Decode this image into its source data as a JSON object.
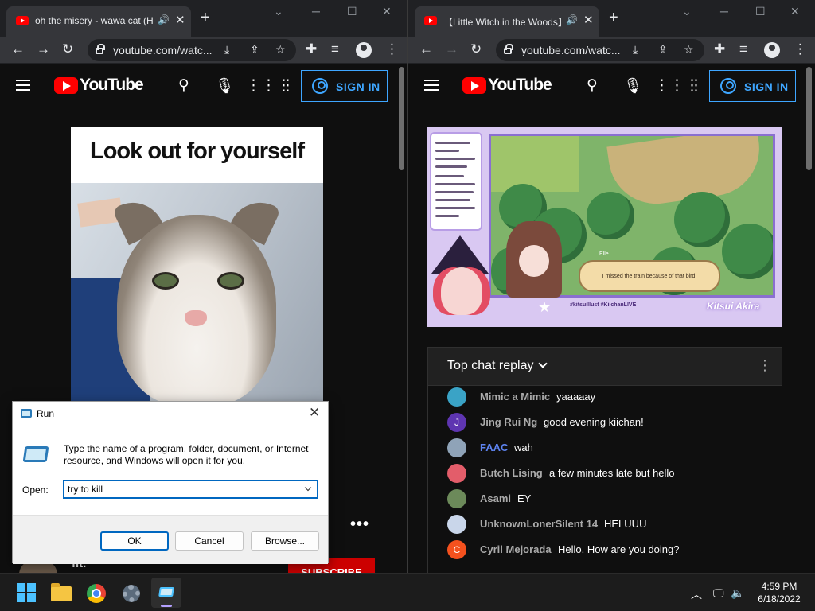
{
  "left_window": {
    "tab_title": "oh the misery - wawa cat (H",
    "url": "youtube.com/watc...",
    "youtube_logo_text": "YouTube",
    "sign_in_label": "SIGN IN",
    "video_caption": "Look out for yourself",
    "more_label": "•••",
    "channel_name": "fit.",
    "subscribe_label": "SUBSCRIBE"
  },
  "right_window": {
    "tab_title": "【Little Witch in the Woods】",
    "url": "youtube.com/watc...",
    "youtube_logo_text": "YouTube",
    "sign_in_label": "SIGN IN",
    "game": {
      "speaker": "Elle",
      "dialog": "I missed the train because of that bird.",
      "hashtags": "#kitsuillust #KiichanLIVE",
      "logo": "Kitsui Akira"
    },
    "chat": {
      "header": "Top chat replay",
      "messages": [
        {
          "author": "Mimic a Mimic",
          "text": "yaaaaay",
          "avatar_letter": "",
          "avatar_color": "#3aa3c6",
          "author_color": "#aaaaaa"
        },
        {
          "author": "Jing Rui Ng",
          "text": "good evening kiichan!",
          "avatar_letter": "J",
          "avatar_color": "#5e35b1",
          "author_color": "#aaaaaa"
        },
        {
          "author": "FAAC",
          "text": "wah",
          "avatar_letter": "",
          "avatar_color": "#8fa3b8",
          "author_color": "#5e84f1"
        },
        {
          "author": "Butch Lising",
          "text": "a few minutes late but hello",
          "avatar_letter": "",
          "avatar_color": "#e35d6a",
          "author_color": "#aaaaaa"
        },
        {
          "author": "Asami",
          "text": "EY",
          "avatar_letter": "",
          "avatar_color": "#6c8a5a",
          "author_color": "#aaaaaa"
        },
        {
          "author": "UnknownLonerSilent 14",
          "text": "HELUUU",
          "avatar_letter": "",
          "avatar_color": "#c9d6ea",
          "author_color": "#aaaaaa"
        },
        {
          "author": "Cyril Mejorada",
          "text": "Hello. How are you doing?",
          "avatar_letter": "C",
          "avatar_color": "#f4511e",
          "author_color": "#aaaaaa"
        }
      ]
    }
  },
  "run_dialog": {
    "title": "Run",
    "description": "Type the name of a program, folder, document, or Internet resource, and Windows will open it for you.",
    "open_label": "Open:",
    "input_value": "try to kill",
    "ok_label": "OK",
    "cancel_label": "Cancel",
    "browse_label": "Browse..."
  },
  "taskbar": {
    "time": "4:59 PM",
    "date": "6/18/2022"
  },
  "colors": {
    "yt_red": "#ff0000",
    "accent_blue": "#3ea6ff",
    "win_accent": "#0067c0"
  }
}
